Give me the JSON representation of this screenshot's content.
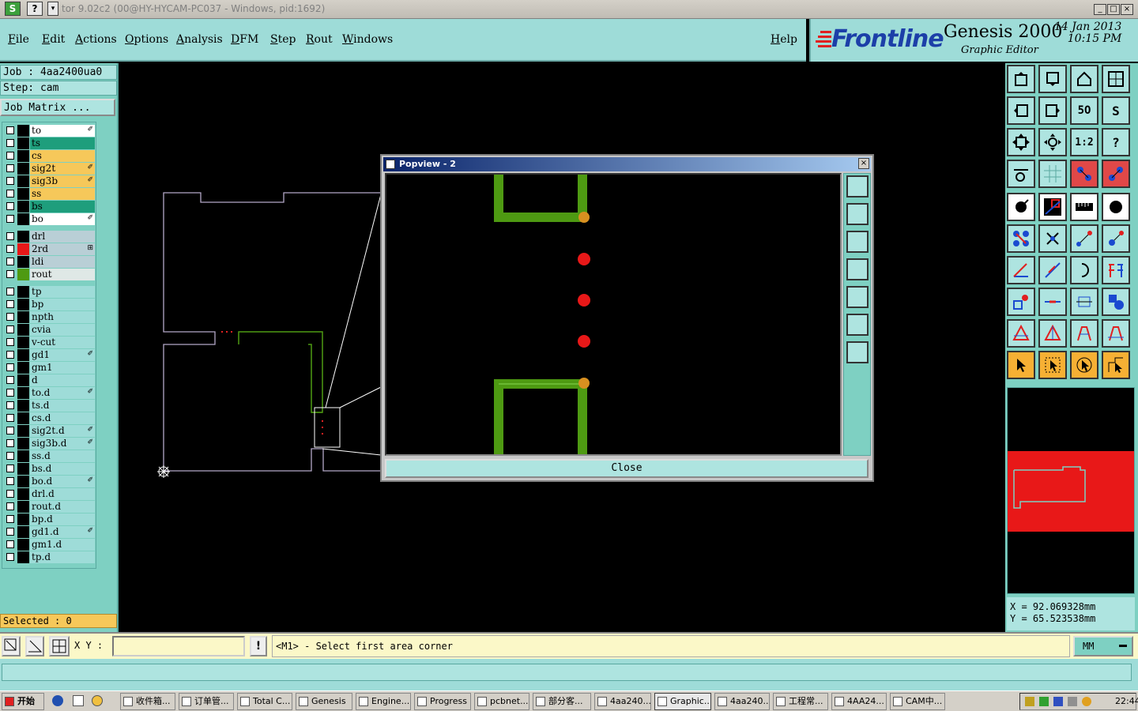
{
  "window": {
    "title": "tor 9.02c2 (00@HY-HYCAM-PC037 - Windows, pid:1692)",
    "app_icon": "S",
    "help_icon": "?"
  },
  "menu": [
    "File",
    "Edit",
    "Actions",
    "Options",
    "Analysis",
    "DFM",
    "Step",
    "Rout",
    "Windows"
  ],
  "help": "Help",
  "brand": {
    "logo": "Frontline",
    "product": "Genesis 2000",
    "subtitle": "Graphic Editor",
    "date": "14 Jan 2013",
    "time": "10:15 PM"
  },
  "job": {
    "job_label": "Job : 4aa2400ua0",
    "step_label": "Step: cam",
    "matrix_button": "Job Matrix ..."
  },
  "layers": [
    {
      "name": "to",
      "color": "#ffffff",
      "mark": "✐"
    },
    {
      "name": "ts",
      "color": "#1e9e7c",
      "mark": ""
    },
    {
      "name": "cs",
      "color": "#f6c85a",
      "mark": ""
    },
    {
      "name": "sig2t",
      "color": "#f6c85a",
      "mark": "✐"
    },
    {
      "name": "sig3b",
      "color": "#f6c85a",
      "mark": "✐"
    },
    {
      "name": "ss",
      "color": "#f6c85a",
      "mark": ""
    },
    {
      "name": "bs",
      "color": "#1e9e7c",
      "mark": ""
    },
    {
      "name": "bo",
      "color": "#ffffff",
      "mark": "✐"
    },
    {
      "name": "drl",
      "color": "#b9cfd6",
      "mark": ""
    },
    {
      "name": "2rd",
      "color": "#b9cfd6",
      "mark": "⊞"
    },
    {
      "name": "ldi",
      "color": "#b9cfd6",
      "mark": ""
    },
    {
      "name": "rout",
      "color": "#dfe8e6",
      "mark": ""
    },
    {
      "name": "tp",
      "color": "#9edcd8",
      "mark": ""
    },
    {
      "name": "bp",
      "color": "#9edcd8",
      "mark": ""
    },
    {
      "name": "npth",
      "color": "#9edcd8",
      "mark": ""
    },
    {
      "name": "cvia",
      "color": "#9edcd8",
      "mark": ""
    },
    {
      "name": "v-cut",
      "color": "#9edcd8",
      "mark": ""
    },
    {
      "name": "gd1",
      "color": "#9edcd8",
      "mark": "✐"
    },
    {
      "name": "gm1",
      "color": "#9edcd8",
      "mark": ""
    },
    {
      "name": "d",
      "color": "#9edcd8",
      "mark": ""
    },
    {
      "name": "to.d",
      "color": "#9edcd8",
      "mark": "✐"
    },
    {
      "name": "ts.d",
      "color": "#9edcd8",
      "mark": ""
    },
    {
      "name": "cs.d",
      "color": "#9edcd8",
      "mark": ""
    },
    {
      "name": "sig2t.d",
      "color": "#9edcd8",
      "mark": "✐"
    },
    {
      "name": "sig3b.d",
      "color": "#9edcd8",
      "mark": "✐"
    },
    {
      "name": "ss.d",
      "color": "#9edcd8",
      "mark": ""
    },
    {
      "name": "bs.d",
      "color": "#9edcd8",
      "mark": ""
    },
    {
      "name": "bo.d",
      "color": "#9edcd8",
      "mark": "✐"
    },
    {
      "name": "drl.d",
      "color": "#9edcd8",
      "mark": ""
    },
    {
      "name": "rout.d",
      "color": "#9edcd8",
      "mark": ""
    },
    {
      "name": "bp.d",
      "color": "#9edcd8",
      "mark": ""
    },
    {
      "name": "gd1.d",
      "color": "#9edcd8",
      "mark": "✐"
    },
    {
      "name": "gm1.d",
      "color": "#9edcd8",
      "mark": ""
    },
    {
      "name": "tp.d",
      "color": "#9edcd8",
      "mark": ""
    }
  ],
  "layer_swatches": {
    "2rd": "#e81818",
    "rout": "#4e9a12"
  },
  "selected": "Selected : 0",
  "status": {
    "xy_label": "X Y :",
    "prompt": "<M1> - Select first area corner",
    "units": "MM"
  },
  "coords": {
    "x": "X = 92.069328mm",
    "y": "Y = 65.523538mm"
  },
  "popview": {
    "title": "Popview - 2",
    "close": "Close"
  },
  "taskbar": {
    "start": "开始",
    "tasks": [
      "收件箱...",
      "订单管...",
      "Total C...",
      "Genesis",
      "Engine...",
      "Progress",
      "pcbnet...",
      "部分客...",
      "4aa240...",
      "Graphic...",
      "4aa240...",
      "工程常...",
      "4AA24...",
      "CAM中..."
    ],
    "clock": "22:44"
  }
}
